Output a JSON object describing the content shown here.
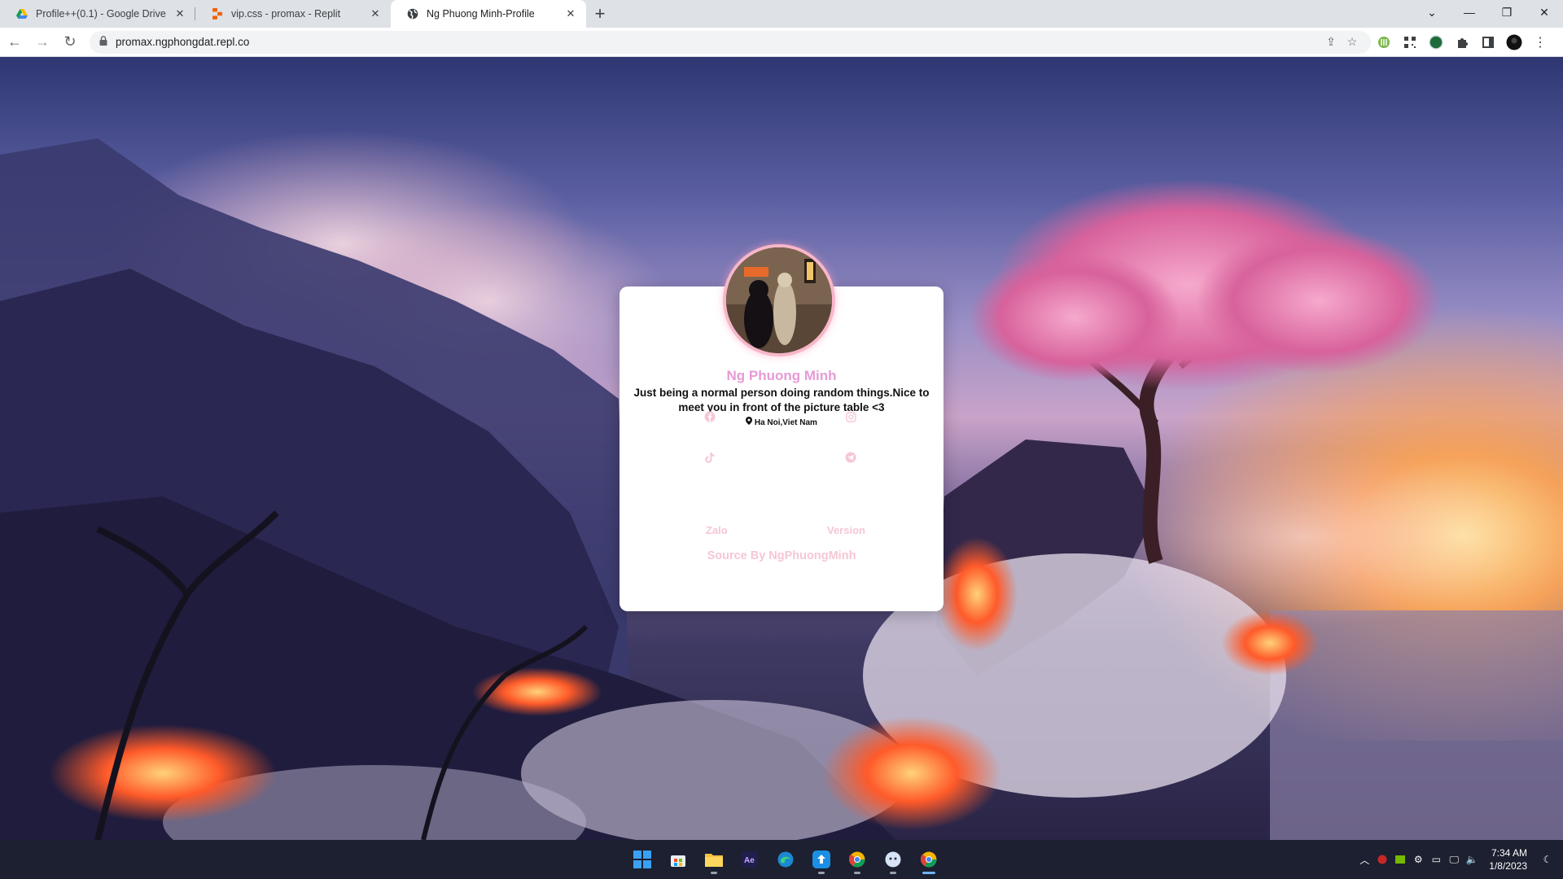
{
  "browser": {
    "tabs": [
      {
        "title": "Profile++(0.1) - Google Drive",
        "icon": "google-drive-icon",
        "active": false
      },
      {
        "title": "vip.css - promax - Replit",
        "icon": "replit-icon",
        "active": false
      },
      {
        "title": "Ng Phuong Minh-Profile",
        "icon": "globe-icon",
        "active": true
      }
    ],
    "url": "promax.ngphongdat.repl.co"
  },
  "profile": {
    "name": "Ng Phuong Minh",
    "bio": "Just being a normal person doing random things.Nice to meet you in front of the picture table <3",
    "location": "Ha Noi,Viet Nam",
    "links": {
      "zalo": "Zalo",
      "version": "Version"
    },
    "source": "Source By NgPhuongMinh",
    "accent_color": "#e79ad6",
    "link_color": "#f6c6d4"
  },
  "taskbar": {
    "time": "7:34 AM",
    "date": "1/8/2023",
    "apps": [
      "windows-start-icon",
      "microsoft-store-icon",
      "file-explorer-icon",
      "after-effects-icon",
      "edge-icon",
      "cloud-upload-icon",
      "chrome-canary-icon",
      "chat-icon",
      "chrome-icon"
    ]
  }
}
